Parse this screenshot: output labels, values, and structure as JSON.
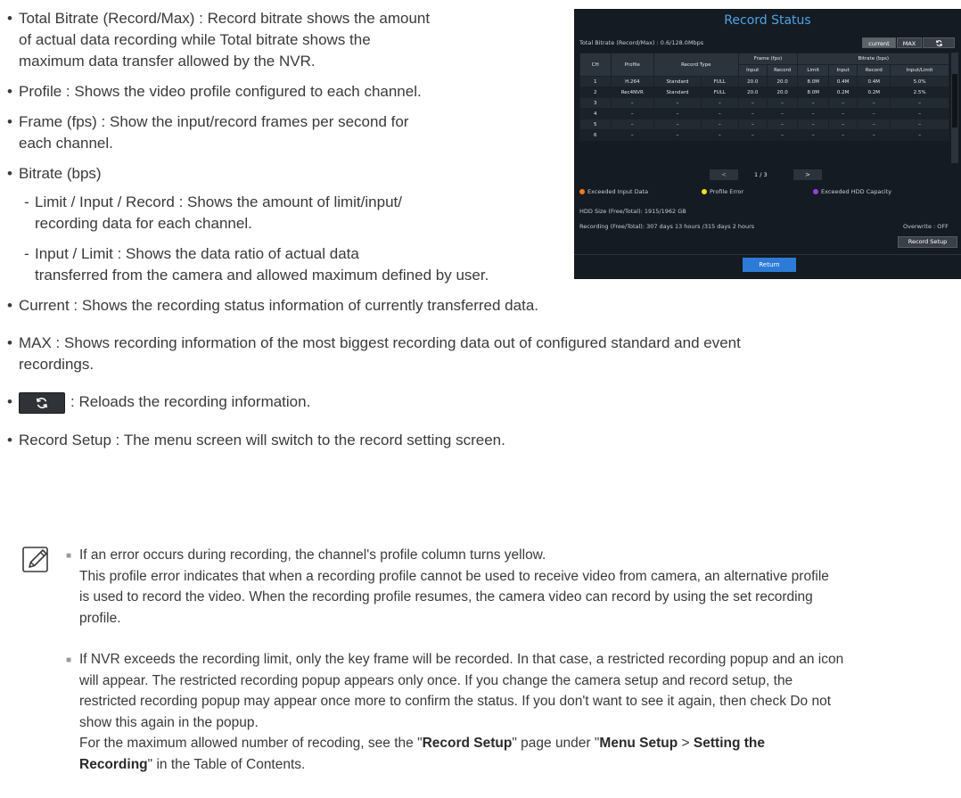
{
  "bullets": {
    "total_l1": "Total Bitrate (Record/Max) : Record bitrate shows the amount",
    "total_l2": "of actual data recording while Total bitrate shows the",
    "total_l3": "maximum data transfer allowed by the NVR.",
    "profile": "Profile : Shows the video profile configured to each channel.",
    "frame_l1": "Frame (fps) : Show the input/record frames per second for",
    "frame_l2": "each channel.",
    "bitrate": "Bitrate (bps)",
    "limit_l1": "Limit / Input / Record : Shows the amount of limit/input/",
    "limit_l2": "recording data for each channel.",
    "ratio_l1": "Input / Limit : Shows the data ratio of actual data",
    "ratio_l2": "transferred from the camera and allowed maximum defined by user.",
    "current": "Current : Shows the recording status information of currently transferred data.",
    "max_l1": "MAX : Shows recording information of the most biggest recording data out of configured standard and event",
    "max_l2": "recordings.",
    "reload": ": Reloads the recording information.",
    "record_setup": "Record Setup : The menu screen will switch to the record setting screen."
  },
  "panel": {
    "title": "Record Status",
    "total_bitrate": "Total Bitrate (Record/Max) : 0.6/128.0Mbps",
    "current_btn": "current",
    "max_btn": "MAX",
    "headers": {
      "ch": "CH",
      "profile": "Profile",
      "record_type": "Record Type",
      "frame": "Frame (fps)",
      "bitrate": "Bitrate (bps)",
      "input": "Input",
      "record": "Record",
      "limit": "Limit",
      "input2": "Input",
      "record2": "Record",
      "input_limit": "Input/Limit"
    },
    "rows": [
      {
        "ch": "1",
        "profile": "H.264",
        "type": "Standard",
        "mode": "FULL",
        "f_in": "20.0",
        "f_rec": "20.0",
        "limit": "8.0M",
        "b_in": "0.4M",
        "b_rec": "0.4M",
        "ratio": "5.0%"
      },
      {
        "ch": "2",
        "profile": "Rec4NVR",
        "type": "Standard",
        "mode": "FULL",
        "f_in": "20.0",
        "f_rec": "20.0",
        "limit": "8.0M",
        "b_in": "0.2M",
        "b_rec": "0.2M",
        "ratio": "2.5%"
      },
      {
        "ch": "3",
        "profile": "–",
        "type": "–",
        "mode": "–",
        "f_in": "–",
        "f_rec": "–",
        "limit": "–",
        "b_in": "–",
        "b_rec": "–",
        "ratio": "–"
      },
      {
        "ch": "4",
        "profile": "–",
        "type": "–",
        "mode": "–",
        "f_in": "–",
        "f_rec": "–",
        "limit": "–",
        "b_in": "–",
        "b_rec": "–",
        "ratio": "–"
      },
      {
        "ch": "5",
        "profile": "–",
        "type": "–",
        "mode": "–",
        "f_in": "–",
        "f_rec": "–",
        "limit": "–",
        "b_in": "–",
        "b_rec": "–",
        "ratio": "–"
      },
      {
        "ch": "6",
        "profile": "–",
        "type": "–",
        "mode": "–",
        "f_in": "–",
        "f_rec": "–",
        "limit": "–",
        "b_in": "–",
        "b_rec": "–",
        "ratio": "–"
      }
    ],
    "page": "1 / 3",
    "prev_btn": "<",
    "next_btn": ">",
    "legend": {
      "exceeded_input": "Exceeded Input Data",
      "profile_error": "Profile Error",
      "exceeded_hdd": "Exceeded HDD Capacity",
      "colors": {
        "orange": "#f07a1a",
        "yellow": "#f2e21b",
        "purple": "#9a3ee0"
      }
    },
    "hdd_size": "HDD Size  (Free/Total): 1915/1962 GB",
    "recording": "Recording (Free/Total): 307 days 13 hours /315 days 2 hours",
    "overwrite": "Overwrite : OFF",
    "record_setup_btn": "Record Setup",
    "return_btn": "Return"
  },
  "note": {
    "p1_l1": "If an error occurs during recording, the channel's profile column turns yellow.",
    "p1_l2": "This profile error indicates that when a recording profile cannot be used to receive video from camera, an alternative profile",
    "p1_l3": "is used to record the video. When the recording profile resumes, the camera video can record by using the set recording",
    "p1_l4": "profile.",
    "p2_l1": "If NVR exceeds the recording limit, only the key frame will be recorded. In that case, a restricted recording popup and an icon",
    "p2_l2": "will appear. The restricted recording popup appears only once. If you change the camera setup and record setup, the",
    "p2_l3": "restricted recording popup may appear once more to confirm the status. If you don't want to see it again, then check Do not",
    "p2_l4": "show this again in the popup.",
    "p2_l5_pre": "For the maximum allowed number of recoding, see the \"",
    "p2_l5_b1": "Record Setup",
    "p2_l5_mid": "\" page under \"",
    "p2_l5_b2": "Menu Setup",
    "p2_l5_gt": " > ",
    "p2_l5_b3": "Setting the",
    "p2_l6_b": "Recording",
    "p2_l6_post": "\" in the Table of Contents."
  },
  "glyphs": {
    "bullet": "•",
    "dash": "-",
    "square": "■"
  }
}
